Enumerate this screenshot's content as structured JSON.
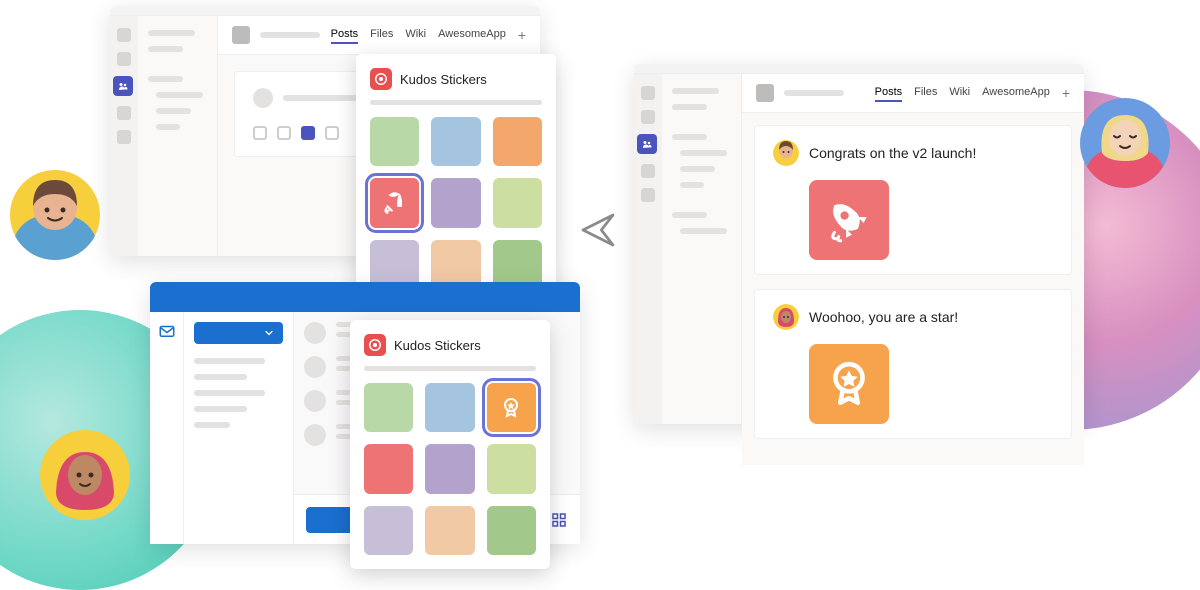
{
  "colors": {
    "brand_purple": "#4b53bc",
    "outlook_blue": "#1a6fcf",
    "rocket_sticker": "#ed7374",
    "star_sticker": "#f6a34b",
    "sticker_tiles": [
      "#b8d9a7",
      "#a4c4e0",
      "#f4a76a",
      "#ed7374",
      "#b3a2cc",
      "#cddfa0",
      "#c6bfd7",
      "#f2c9a5",
      "#a2c98b"
    ]
  },
  "tabs": {
    "posts": "Posts",
    "files": "Files",
    "wiki": "Wiki",
    "awesome": "AwesomeApp",
    "plus": "+"
  },
  "sticker_panel": {
    "title": "Kudos Stickers",
    "icon_name": "target-icon"
  },
  "messages": {
    "m1": "Congrats on the v2 launch!",
    "m2": "Woohoo, you are a star!"
  },
  "icons": {
    "rocket": "rocket-icon",
    "award": "award-icon",
    "mail": "mail-icon",
    "apps": "apps-grid-icon",
    "teams": "teams-icon"
  }
}
